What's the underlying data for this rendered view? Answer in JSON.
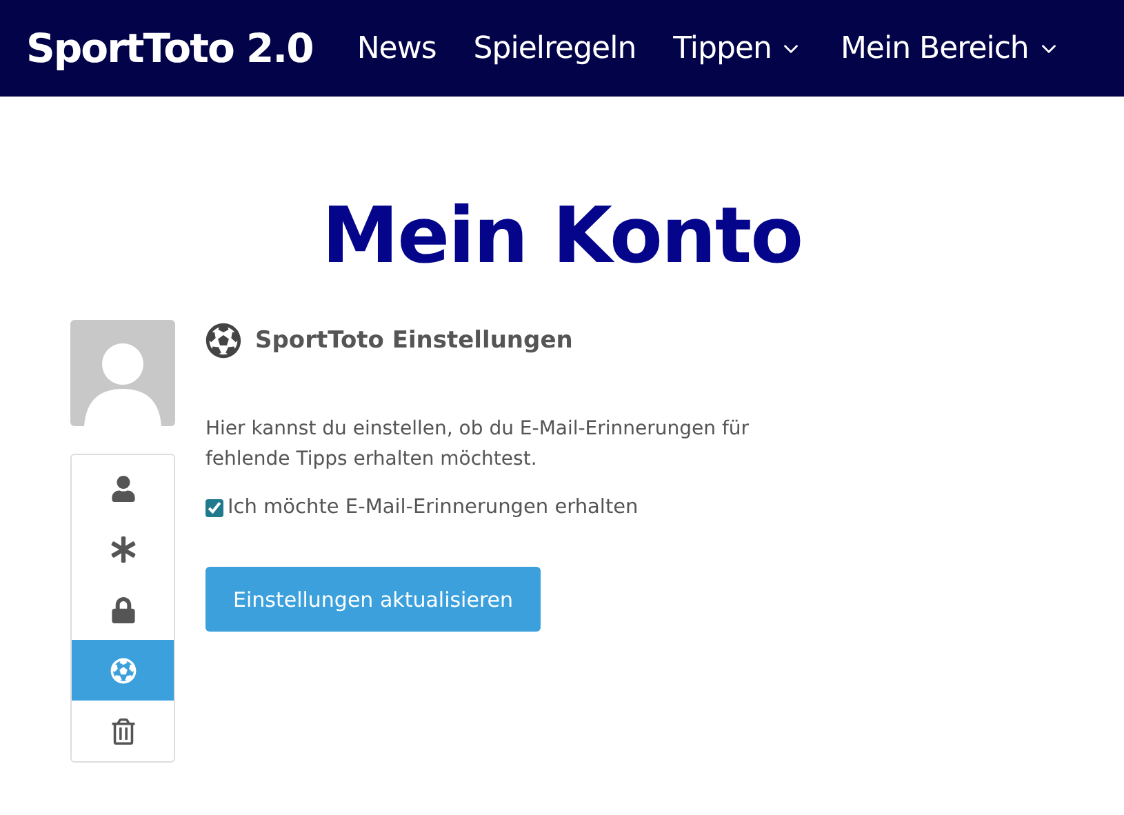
{
  "nav": {
    "brand": "SportToto 2.0",
    "links": [
      {
        "label": "News",
        "dropdown": false
      },
      {
        "label": "Spielregeln",
        "dropdown": false
      },
      {
        "label": "Tippen",
        "dropdown": true
      },
      {
        "label": "Mein Bereich",
        "dropdown": true
      }
    ]
  },
  "page_title": "Mein Konto",
  "sidebar": {
    "items": [
      {
        "kind": "profile",
        "selected": false
      },
      {
        "kind": "password",
        "selected": false
      },
      {
        "kind": "privacy",
        "selected": false
      },
      {
        "kind": "sporttoto",
        "selected": true
      },
      {
        "kind": "delete",
        "selected": false
      }
    ]
  },
  "section": {
    "heading": "SportToto Einstellungen",
    "description": "Hier kannst du einstellen, ob du E-Mail-Erinnerungen für fehlende Tipps erhalten möchtest.",
    "checkbox": {
      "label": "Ich möchte E-Mail-Erinnerungen erhalten",
      "checked": true
    },
    "button": "Einstellungen aktualisieren"
  }
}
